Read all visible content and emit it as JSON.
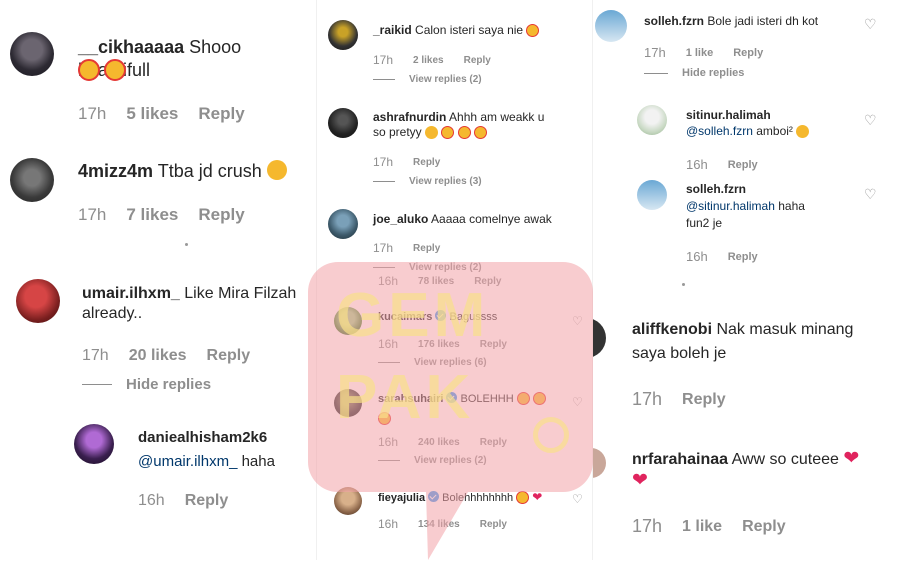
{
  "left": {
    "c1": {
      "user": "__cikhaaaaa",
      "text": "Shooo beautifull",
      "time": "17h",
      "likes": "5 likes",
      "reply": "Reply"
    },
    "c2": {
      "user": "4mizz4m",
      "text": "Ttba jd crush",
      "time": "17h",
      "likes": "7 likes",
      "reply": "Reply"
    },
    "c3": {
      "user": "umair.ilhxm_",
      "text": "Like Mira Filzah",
      "text2": "already..",
      "time": "17h",
      "likes": "20 likes",
      "reply": "Reply",
      "hide": "Hide replies"
    },
    "c4": {
      "user": "danieal­hisham2k6",
      "mention": "@umair.ilhxm_",
      "text": "haha",
      "time": "16h",
      "reply": "Reply"
    }
  },
  "mid": {
    "c1": {
      "user": "_raikid",
      "text": "Calon isteri saya nie",
      "time": "17h",
      "likes": "2 likes",
      "reply": "Reply",
      "view": "View replies (2)"
    },
    "c2": {
      "user": "ashrafnurdin",
      "text": "Ahhh am weakk u",
      "text2": "so pretyy",
      "time": "17h",
      "reply": "Reply",
      "view": "View replies (3)"
    },
    "c3": {
      "user": "joe_aluko",
      "text": "Aaaaa comelnye awak",
      "time": "17h",
      "reply": "Reply",
      "view": "View replies (2)"
    },
    "c4": {
      "time": "16h",
      "likes": "78 likes",
      "reply": "Reply"
    },
    "c5": {
      "user": "kucaimars",
      "text": "Bagussss",
      "time": "16h",
      "likes": "176 likes",
      "reply": "Reply",
      "view": "View replies (6)"
    },
    "c6": {
      "user": "sarahsuhairi",
      "text": "BOLEHHH",
      "time": "16h",
      "likes": "240 likes",
      "reply": "Reply",
      "view": "View replies (2)"
    },
    "c7": {
      "user": "fieyajulia",
      "text": "Bolehhhhhhhh",
      "time": "16h",
      "likes": "134 likes",
      "reply": "Reply"
    }
  },
  "right": {
    "c1": {
      "user": "solleh.fzrn",
      "text": "Bole jadi isteri dh kot",
      "time": "17h",
      "likes": "1 like",
      "reply": "Reply",
      "hide": "Hide replies"
    },
    "c2": {
      "user": "sitinur.halimah",
      "mention": "@solleh.fzrn",
      "text": "amboi²",
      "time": "16h",
      "reply": "Reply"
    },
    "c3": {
      "user": "solleh.fzrn",
      "mention": "@sitinur.halimah",
      "text": "haha",
      "text2": "fun2 je",
      "time": "16h",
      "reply": "Reply"
    },
    "c4": {
      "user": "aliffkenobi",
      "text": "Nak masuk minang",
      "text2": "saya boleh je",
      "time": "17h",
      "reply": "Reply"
    },
    "c5": {
      "user": "nrfarahainaa",
      "text": "Aww so cuteee",
      "time": "17h",
      "likes": "1 like",
      "reply": "Reply"
    }
  },
  "watermark": {
    "line1": "GEM",
    "line2": "PAK"
  },
  "colors": {
    "watermark": "#f2a3a8",
    "watermark_text": "#f9e08a",
    "heart": "#e0245e",
    "emoji": "#f5b82e"
  }
}
